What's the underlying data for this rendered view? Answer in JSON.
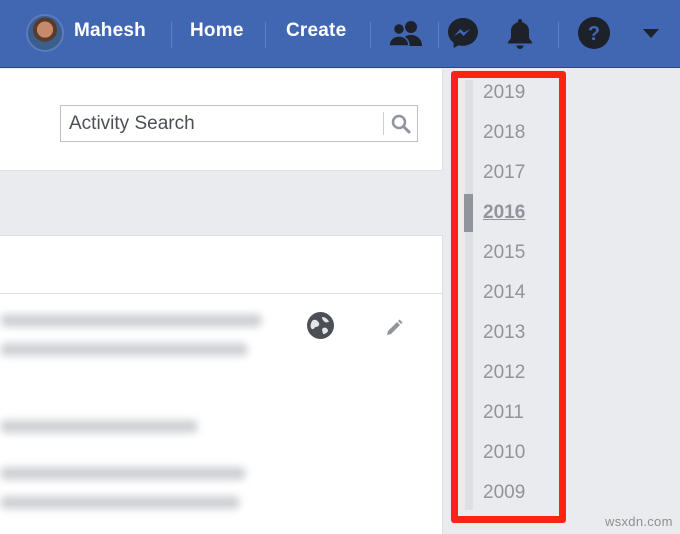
{
  "topbar": {
    "user_name": "Mahesh",
    "home_label": "Home",
    "create_label": "Create",
    "background_color": "#4267b2",
    "icons": [
      "friends-icon",
      "messenger-icon",
      "notifications-bell-icon",
      "help-icon",
      "account-menu-caret-icon"
    ]
  },
  "activity_log": {
    "search_placeholder": "Activity Search",
    "search_icon": "search-icon",
    "entry_icons": [
      "globe-privacy-icon",
      "pencil-edit-icon"
    ]
  },
  "year_nav": {
    "years": [
      "2019",
      "2018",
      "2017",
      "2016",
      "2015",
      "2014",
      "2013",
      "2012",
      "2011",
      "2010",
      "2009"
    ],
    "active_year": "2016",
    "highlight_color": "#f92415"
  },
  "watermark": "wsxdn.com"
}
